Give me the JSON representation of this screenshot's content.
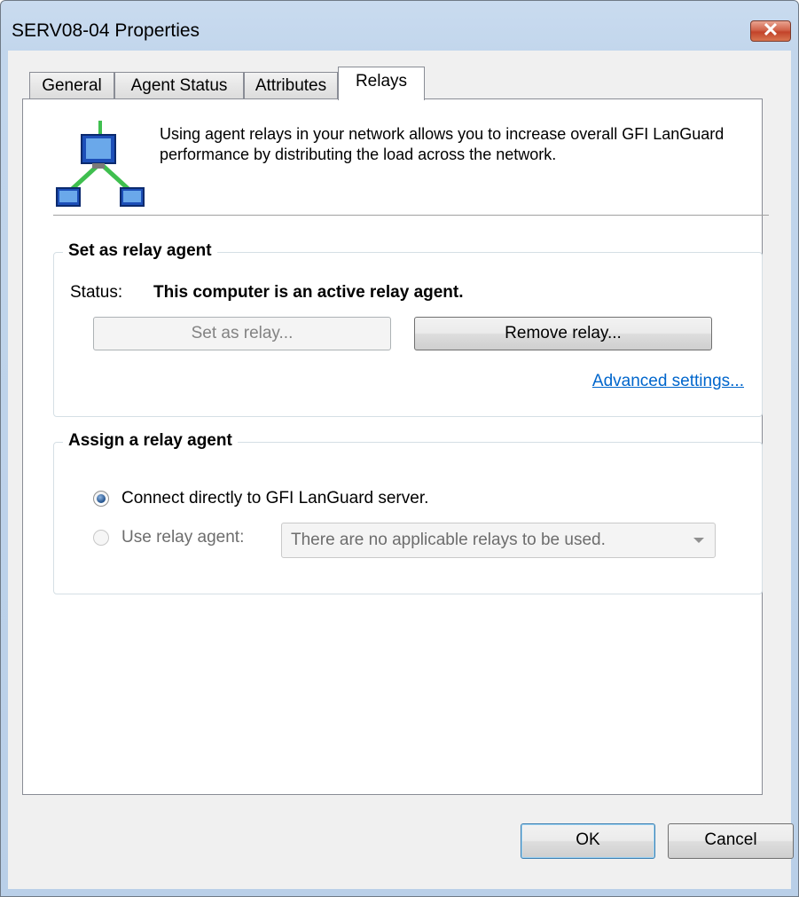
{
  "window": {
    "title": "SERV08-04 Properties"
  },
  "tabs": [
    {
      "label": "General"
    },
    {
      "label": "Agent Status"
    },
    {
      "label": "Attributes"
    },
    {
      "label": "Relays"
    }
  ],
  "intro": {
    "text": "Using agent relays in your network allows you to increase overall GFI LanGuard performance by distributing the load across the network."
  },
  "set_relay": {
    "title": "Set as relay agent",
    "status_label": "Status:",
    "status_value": "This computer is an active relay agent.",
    "set_button": "Set as relay...",
    "remove_button": "Remove relay...",
    "advanced_link": "Advanced settings..."
  },
  "assign_relay": {
    "title": "Assign a relay agent",
    "option_direct": "Connect directly to GFI LanGuard server.",
    "option_relay": "Use relay agent:",
    "relay_select_value": "There are no applicable relays to be used."
  },
  "footer": {
    "ok": "OK",
    "cancel": "Cancel"
  },
  "colors": {
    "accent_link": "#0066cc",
    "close_button": "#c3432a",
    "window_frame": "#c2d6ec"
  }
}
